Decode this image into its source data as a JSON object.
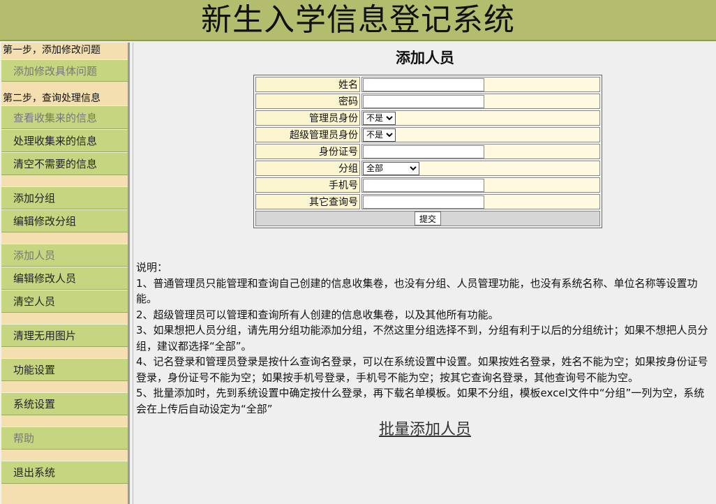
{
  "header": {
    "title": "新生入学信息登记系统"
  },
  "sidebar": {
    "step1_title": "第一步，添加修改问题",
    "step1_items": [
      "添加修改具体问题"
    ],
    "step2_title": "第二步，查询处理信息",
    "step2_items": [
      "查看收集来的信息",
      "处理收集来的信息",
      "清空不需要的信息"
    ],
    "group_items": [
      "添加分组",
      "编辑修改分组"
    ],
    "people_items": [
      "添加人员",
      "编辑修改人员",
      "清空人员"
    ],
    "cleanup_item": "清理无用图片",
    "function_settings": "功能设置",
    "system_settings": "系统设置",
    "help": "帮助",
    "logout": "退出系统"
  },
  "form": {
    "title": "添加人员",
    "labels": {
      "name": "姓名",
      "password": "密码",
      "admin": "管理员身份",
      "super_admin": "超级管理员身份",
      "id_number": "身份证号",
      "group": "分组",
      "phone": "手机号",
      "other": "其它查询号"
    },
    "admin_value": "不是",
    "super_admin_value": "不是",
    "group_value": "全部",
    "submit_label": "提交"
  },
  "notes": {
    "heading": "说明：",
    "lines": [
      "1、普通管理员只能管理和查询自己创建的信息收集卷，也没有分组、人员管理功能，也没有系统名称、单位名称等设置功能。",
      "2、超级管理员可以管理和查询所有人创建的信息收集卷，以及其他所有功能。",
      "3、如果想把人员分组，请先用分组功能添加分组，不然这里分组选择不到，分组有利于以后的分组统计；如果不想把人员分组，建议都选择“全部”。",
      "4、记名登录和管理员登录是按什么查询名登录，可以在系统设置中设置。如果按姓名登录，姓名不能为空；如果按身份证号登录，身份证号不能为空；如果按手机号登录，手机号不能为空；按其它查询名登录，其他查询号不能为空。",
      "5、批量添加时，先到系统设置中确定按什么登录，再下载名单模板。如果不分组，模板excel文件中“分组”一列为空，系统会在上传后自动设定为“全部”"
    ]
  },
  "bulk_link": "批量添加人员"
}
